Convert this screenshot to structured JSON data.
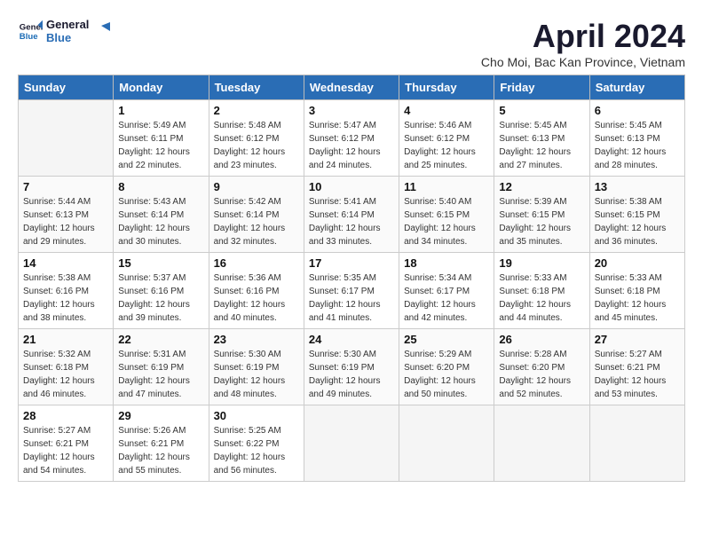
{
  "header": {
    "logo_line1": "General",
    "logo_line2": "Blue",
    "title": "April 2024",
    "subtitle": "Cho Moi, Bac Kan Province, Vietnam"
  },
  "weekdays": [
    "Sunday",
    "Monday",
    "Tuesday",
    "Wednesday",
    "Thursday",
    "Friday",
    "Saturday"
  ],
  "weeks": [
    [
      {
        "day": "",
        "empty": true
      },
      {
        "day": "1",
        "sunrise": "5:49 AM",
        "sunset": "6:11 PM",
        "daylight": "12 hours and 22 minutes."
      },
      {
        "day": "2",
        "sunrise": "5:48 AM",
        "sunset": "6:12 PM",
        "daylight": "12 hours and 23 minutes."
      },
      {
        "day": "3",
        "sunrise": "5:47 AM",
        "sunset": "6:12 PM",
        "daylight": "12 hours and 24 minutes."
      },
      {
        "day": "4",
        "sunrise": "5:46 AM",
        "sunset": "6:12 PM",
        "daylight": "12 hours and 25 minutes."
      },
      {
        "day": "5",
        "sunrise": "5:45 AM",
        "sunset": "6:13 PM",
        "daylight": "12 hours and 27 minutes."
      },
      {
        "day": "6",
        "sunrise": "5:45 AM",
        "sunset": "6:13 PM",
        "daylight": "12 hours and 28 minutes."
      }
    ],
    [
      {
        "day": "7",
        "sunrise": "5:44 AM",
        "sunset": "6:13 PM",
        "daylight": "12 hours and 29 minutes."
      },
      {
        "day": "8",
        "sunrise": "5:43 AM",
        "sunset": "6:14 PM",
        "daylight": "12 hours and 30 minutes."
      },
      {
        "day": "9",
        "sunrise": "5:42 AM",
        "sunset": "6:14 PM",
        "daylight": "12 hours and 32 minutes."
      },
      {
        "day": "10",
        "sunrise": "5:41 AM",
        "sunset": "6:14 PM",
        "daylight": "12 hours and 33 minutes."
      },
      {
        "day": "11",
        "sunrise": "5:40 AM",
        "sunset": "6:15 PM",
        "daylight": "12 hours and 34 minutes."
      },
      {
        "day": "12",
        "sunrise": "5:39 AM",
        "sunset": "6:15 PM",
        "daylight": "12 hours and 35 minutes."
      },
      {
        "day": "13",
        "sunrise": "5:38 AM",
        "sunset": "6:15 PM",
        "daylight": "12 hours and 36 minutes."
      }
    ],
    [
      {
        "day": "14",
        "sunrise": "5:38 AM",
        "sunset": "6:16 PM",
        "daylight": "12 hours and 38 minutes."
      },
      {
        "day": "15",
        "sunrise": "5:37 AM",
        "sunset": "6:16 PM",
        "daylight": "12 hours and 39 minutes."
      },
      {
        "day": "16",
        "sunrise": "5:36 AM",
        "sunset": "6:16 PM",
        "daylight": "12 hours and 40 minutes."
      },
      {
        "day": "17",
        "sunrise": "5:35 AM",
        "sunset": "6:17 PM",
        "daylight": "12 hours and 41 minutes."
      },
      {
        "day": "18",
        "sunrise": "5:34 AM",
        "sunset": "6:17 PM",
        "daylight": "12 hours and 42 minutes."
      },
      {
        "day": "19",
        "sunrise": "5:33 AM",
        "sunset": "6:18 PM",
        "daylight": "12 hours and 44 minutes."
      },
      {
        "day": "20",
        "sunrise": "5:33 AM",
        "sunset": "6:18 PM",
        "daylight": "12 hours and 45 minutes."
      }
    ],
    [
      {
        "day": "21",
        "sunrise": "5:32 AM",
        "sunset": "6:18 PM",
        "daylight": "12 hours and 46 minutes."
      },
      {
        "day": "22",
        "sunrise": "5:31 AM",
        "sunset": "6:19 PM",
        "daylight": "12 hours and 47 minutes."
      },
      {
        "day": "23",
        "sunrise": "5:30 AM",
        "sunset": "6:19 PM",
        "daylight": "12 hours and 48 minutes."
      },
      {
        "day": "24",
        "sunrise": "5:30 AM",
        "sunset": "6:19 PM",
        "daylight": "12 hours and 49 minutes."
      },
      {
        "day": "25",
        "sunrise": "5:29 AM",
        "sunset": "6:20 PM",
        "daylight": "12 hours and 50 minutes."
      },
      {
        "day": "26",
        "sunrise": "5:28 AM",
        "sunset": "6:20 PM",
        "daylight": "12 hours and 52 minutes."
      },
      {
        "day": "27",
        "sunrise": "5:27 AM",
        "sunset": "6:21 PM",
        "daylight": "12 hours and 53 minutes."
      }
    ],
    [
      {
        "day": "28",
        "sunrise": "5:27 AM",
        "sunset": "6:21 PM",
        "daylight": "12 hours and 54 minutes."
      },
      {
        "day": "29",
        "sunrise": "5:26 AM",
        "sunset": "6:21 PM",
        "daylight": "12 hours and 55 minutes."
      },
      {
        "day": "30",
        "sunrise": "5:25 AM",
        "sunset": "6:22 PM",
        "daylight": "12 hours and 56 minutes."
      },
      {
        "day": "",
        "empty": true
      },
      {
        "day": "",
        "empty": true
      },
      {
        "day": "",
        "empty": true
      },
      {
        "day": "",
        "empty": true
      }
    ]
  ]
}
